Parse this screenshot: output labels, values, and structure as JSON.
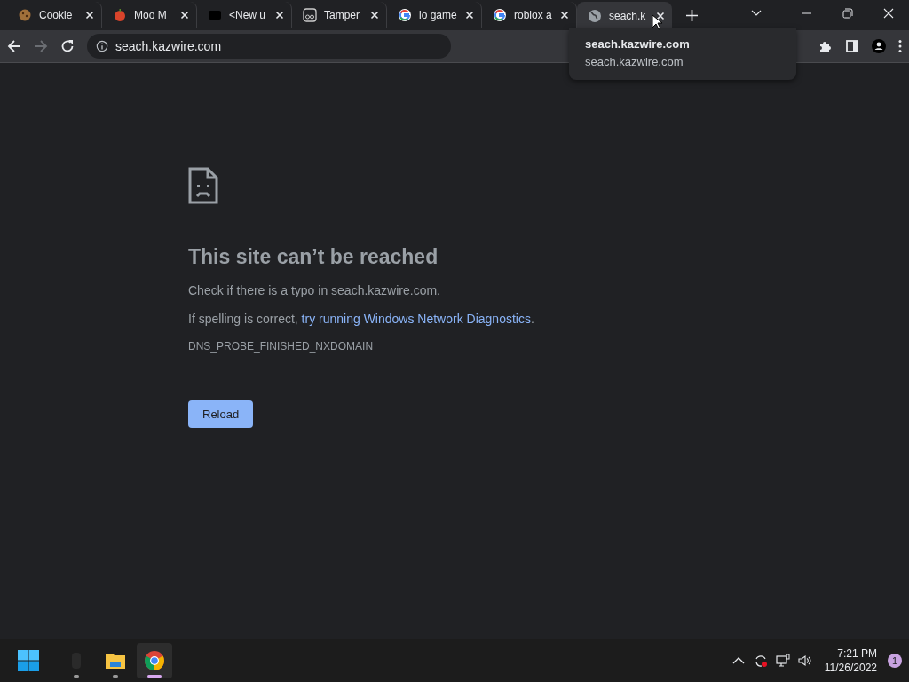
{
  "tabs": [
    {
      "title": "Cookie",
      "kind": "cookie",
      "selected": false
    },
    {
      "title": "Moo M",
      "kind": "apple",
      "selected": false
    },
    {
      "title": "<New u",
      "kind": "dark",
      "selected": false
    },
    {
      "title": "Tamper",
      "kind": "tamper",
      "selected": false
    },
    {
      "title": "io game",
      "kind": "google",
      "selected": false
    },
    {
      "title": "roblox a",
      "kind": "google",
      "selected": false
    },
    {
      "title": "seach.k",
      "kind": "globe",
      "selected": true
    }
  ],
  "tooltip": {
    "title": "seach.kazwire.com",
    "url": "seach.kazwire.com"
  },
  "toolbar": {
    "forward_disabled": true,
    "address": "seach.kazwire.com"
  },
  "error": {
    "heading": "This site can’t be reached",
    "message": "Check if there is a typo in seach.kazwire.com.",
    "hint_before": "If spelling is correct, ",
    "hint_link": "try running Windows Network Diagnostics",
    "hint_after": ".",
    "code": "DNS_PROBE_FINISHED_NXDOMAIN",
    "button": "Reload"
  },
  "taskbar": {
    "apps": [
      {
        "kind": "app",
        "running": true,
        "selected": false
      },
      {
        "kind": "explorer",
        "running": true,
        "selected": false
      },
      {
        "kind": "chrome",
        "running": true,
        "selected": true
      }
    ],
    "time": "7:21 PM",
    "date": "11/26/2022",
    "notifications": "1"
  }
}
